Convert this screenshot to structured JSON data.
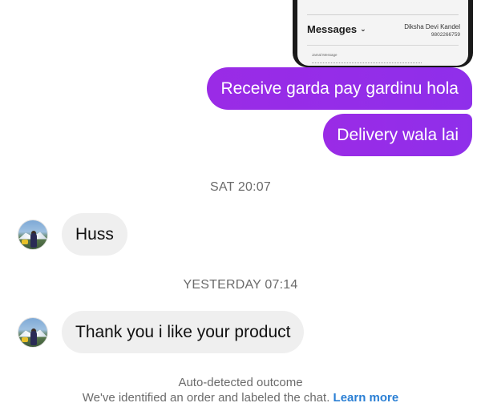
{
  "shared_image": {
    "title": "Messages",
    "chevron_icon": "chevron-down-icon",
    "contact_name": "Diksha Devi Kandel",
    "contact_phone": "9802266759",
    "small_caption": "Jamal Message"
  },
  "outgoing_messages": [
    {
      "text": "Receive garda pay gardinu hola"
    },
    {
      "text": "Delivery wala lai"
    }
  ],
  "timestamps": [
    "SAT 20:07",
    "YESTERDAY 07:14"
  ],
  "incoming_messages": [
    {
      "text": "Huss",
      "avatar": "contact-avatar"
    },
    {
      "text": "Thank you i like your product",
      "avatar": "contact-avatar"
    }
  ],
  "footer": {
    "title": "Auto-detected outcome",
    "description": "We've identified an order and labeled the chat.",
    "link": "Learn more"
  },
  "colors": {
    "outgoing_bubble": "#9a2be6",
    "incoming_bubble": "#efefef",
    "link": "#2a7fd4",
    "muted_text": "#6b6b6b"
  }
}
